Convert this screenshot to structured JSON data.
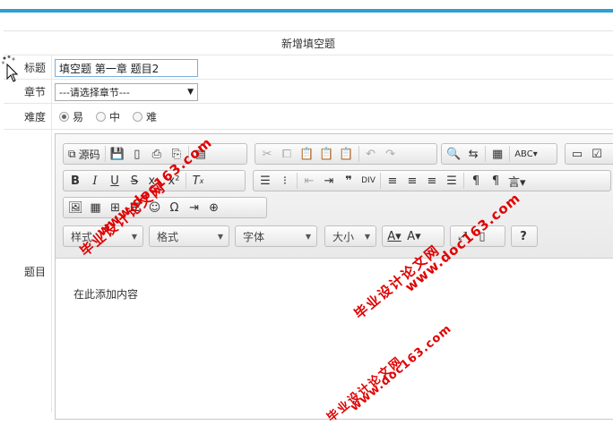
{
  "header": {
    "accent_color": "#2e9fd4"
  },
  "form": {
    "title": "新增填空题",
    "fields": {
      "title_label": "标题",
      "title_value": "填空题 第一章 题目2",
      "chapter_label": "章节",
      "chapter_value": "---请选择章节---",
      "difficulty_label": "难度",
      "difficulty_options": [
        "易",
        "中",
        "难"
      ],
      "difficulty_selected": "易",
      "question_label": "题目"
    }
  },
  "editor": {
    "toolbar": {
      "source_label": "源码",
      "combos": {
        "style": "样式",
        "format": "格式",
        "font": "字体",
        "size": "大小"
      }
    },
    "content": "在此添加内容"
  },
  "watermark": {
    "text_a": "毕业设计论文网",
    "text_b": "www.doc163.com",
    "color": "#e00000"
  }
}
